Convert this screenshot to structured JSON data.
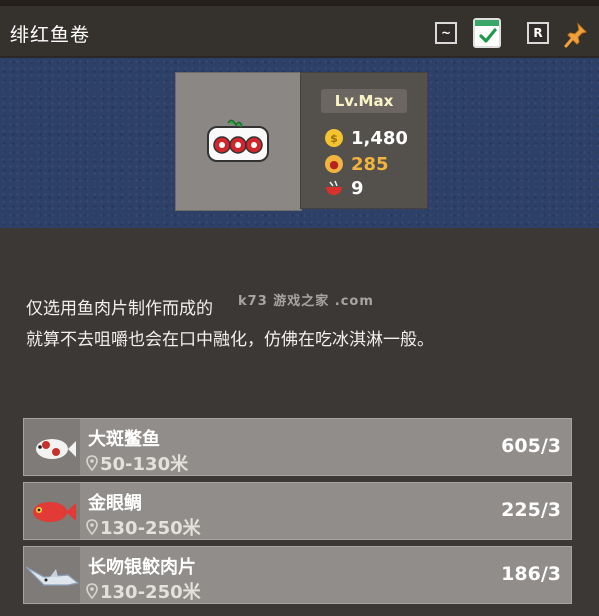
{
  "header": {
    "title": "绯红鱼卷",
    "buttons": {
      "tilde_label": "~",
      "r_label": "R"
    }
  },
  "dish": {
    "icon": "fish-roll-icon",
    "level": "Lv.Max",
    "price": "1,480",
    "taste": "285",
    "portions": "9"
  },
  "description": {
    "line1": "仅选用鱼肉片制作而成的",
    "line2": "就算不去咀嚼也会在口中融化，仿佛在吃冰淇淋一般。",
    "watermark": "k73 游戏之家 .com"
  },
  "ingredients": [
    {
      "name": "大斑鳖鱼",
      "location": "50-130米",
      "count": "605/3",
      "icon": "spotted-fish-icon"
    },
    {
      "name": "金眼鲷",
      "location": "130-250米",
      "count": "225/3",
      "icon": "red-fish-icon"
    },
    {
      "name": "长吻银鲛肉片",
      "location": "130-250米",
      "count": "186/3",
      "icon": "silver-chimaera-icon"
    }
  ],
  "colors": {
    "banner": "#2d4068",
    "gold": "#f4c430",
    "taste": "#f2b441",
    "portion": "#d9322b"
  }
}
